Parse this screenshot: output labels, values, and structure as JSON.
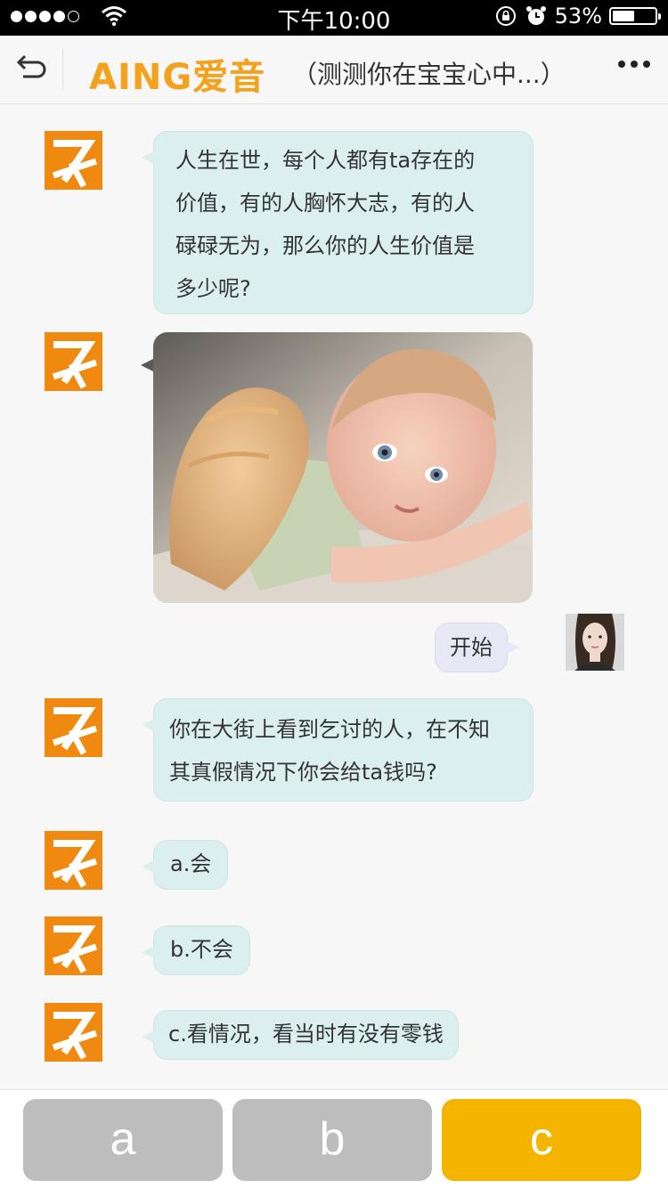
{
  "status_bar": {
    "time": "下午10:00",
    "battery": "53%",
    "battery_level": 0.53,
    "signal_dots_filled": 4,
    "signal_dots_total": 5
  },
  "header": {
    "brand": "AING爱音",
    "title": "（测测你在宝宝心中...）",
    "back_icon": "back-icon",
    "more_icon": "more-icon"
  },
  "messages": {
    "m1": {
      "line1": "人生在世，每个人都有ta存在的",
      "line2": "价值，有的人胸怀大志，有的人",
      "line3": "碌碌无为，那么你的人生价值是",
      "line4": "多少呢?"
    },
    "m2_image": "baby-with-kitten-photo",
    "m3_user": "开始",
    "m4": {
      "line1": "你在大街上看到乞讨的人，在不知",
      "line2": "其真假情况下你会给ta钱吗?"
    },
    "m5": "a.会",
    "m6": "b.不会",
    "m7": "c.看情况，看当时有没有零钱"
  },
  "options": {
    "a": "a",
    "b": "b",
    "c": "c"
  },
  "colors": {
    "brand": "#f2a21c",
    "bubble": "#dcefef",
    "user_bubble": "#e7e7f5",
    "selected_option": "#f5b400",
    "unselected_option": "#bdbdbd"
  }
}
